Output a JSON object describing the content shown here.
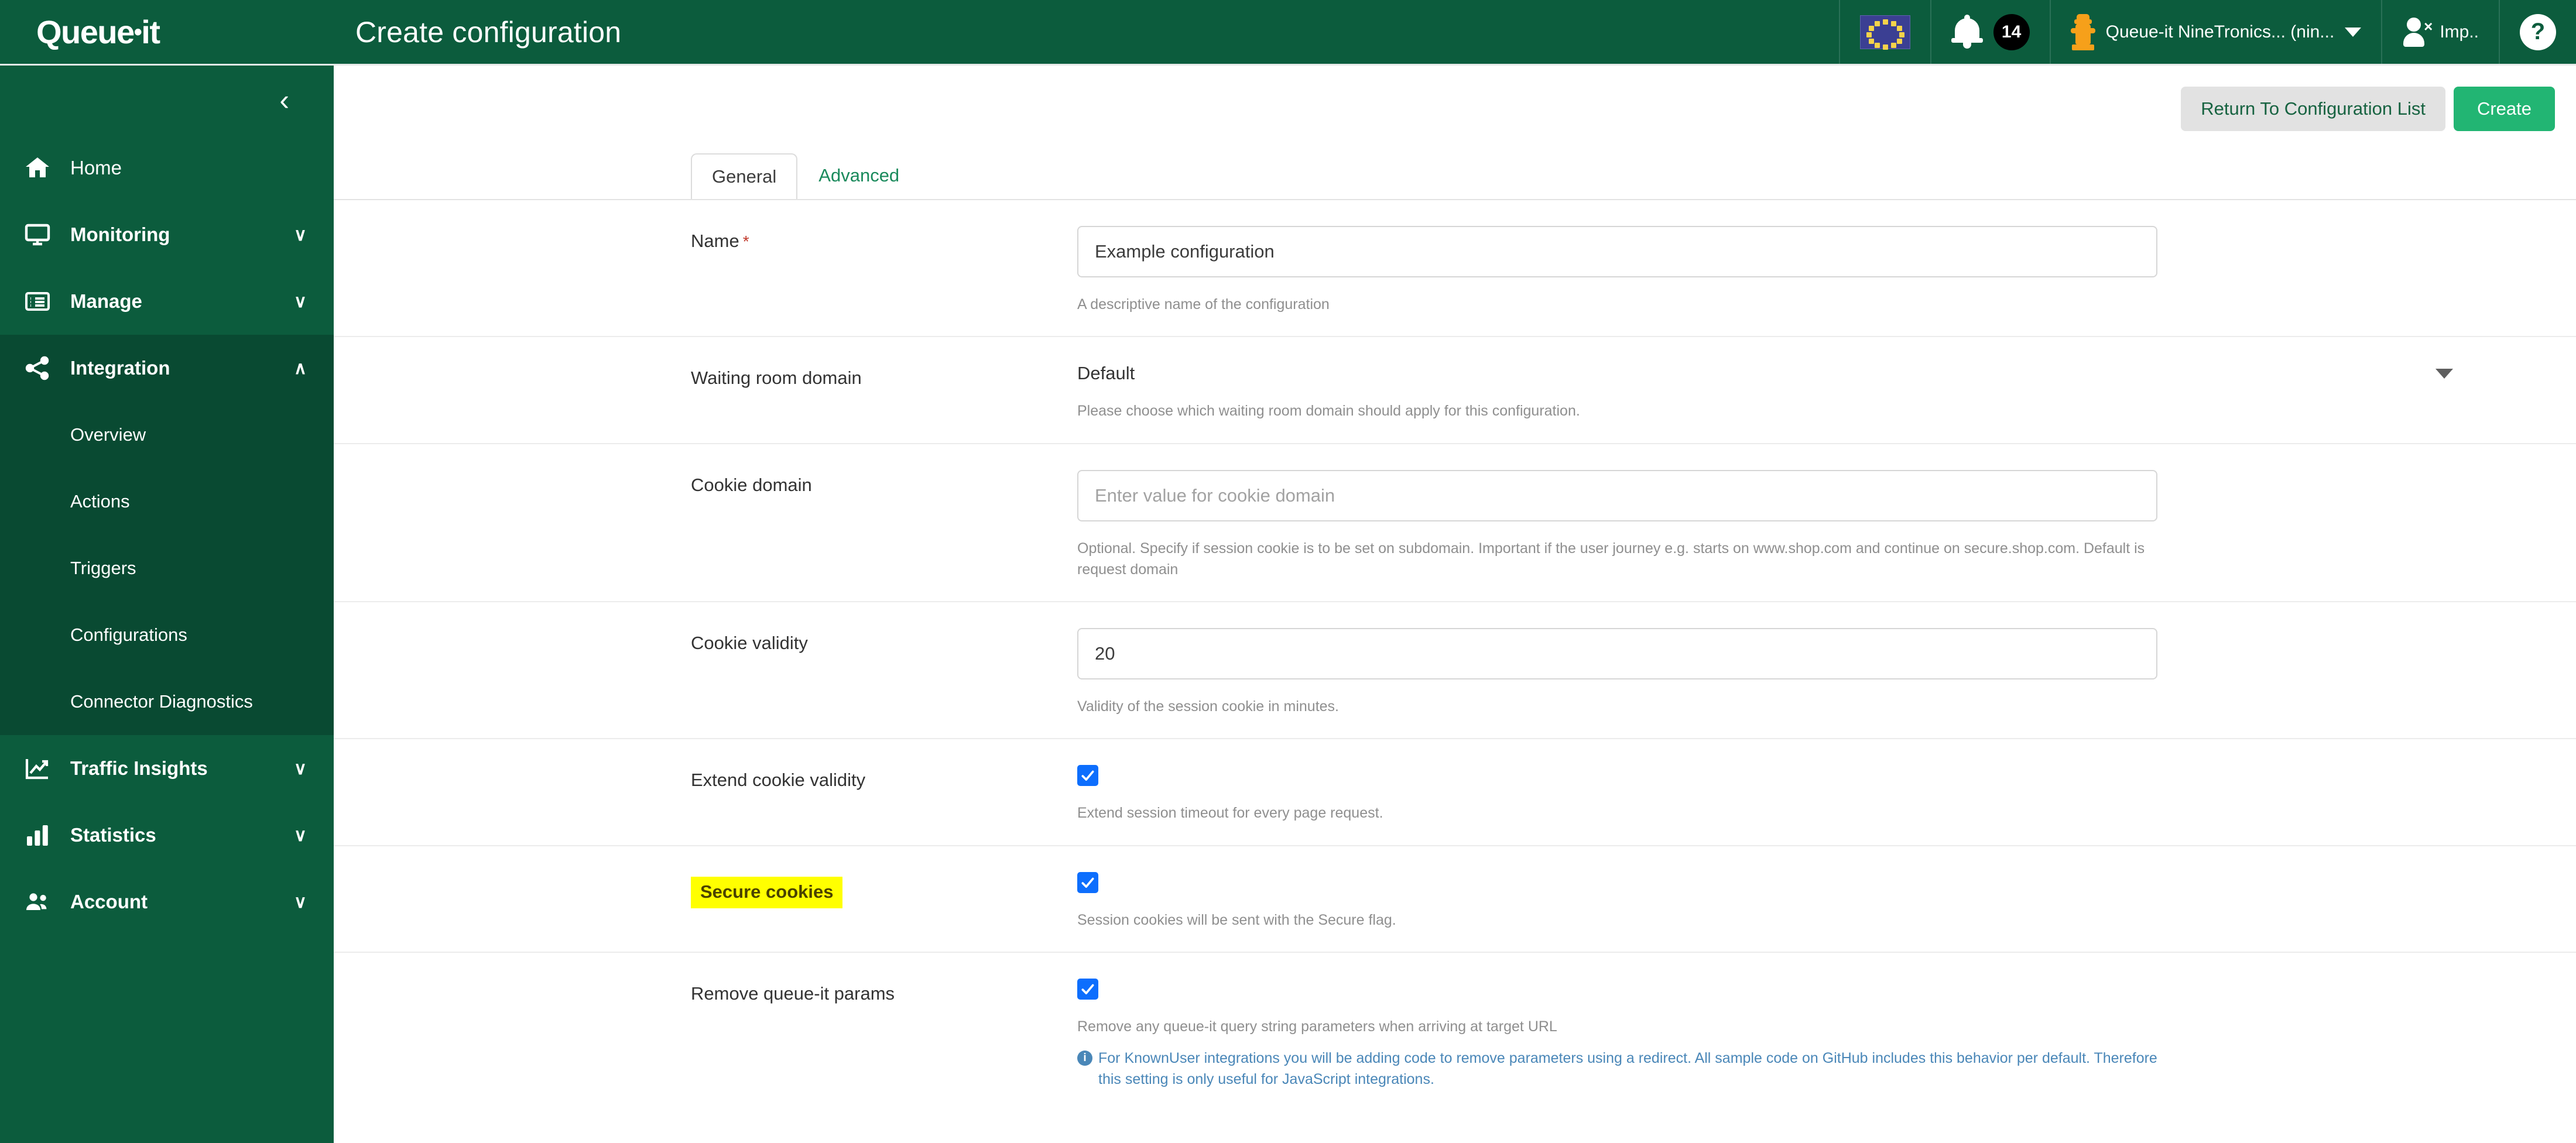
{
  "brand": {
    "name": "Queue",
    "dot": "•",
    "suffix": "it"
  },
  "header": {
    "title": "Create configuration",
    "locale_flag": "eu-flag-icon",
    "notifications_count": "14",
    "account_label": "Queue-it NineTronics... (nin...",
    "impersonate_label": "Imp..",
    "help_label": "?"
  },
  "sidebar": {
    "collapse_label": "‹",
    "items": [
      {
        "label": "Home",
        "icon": "home-icon",
        "caret": ""
      },
      {
        "label": "Monitoring",
        "icon": "monitor-icon",
        "caret": "∨"
      },
      {
        "label": "Manage",
        "icon": "list-icon",
        "caret": "∨"
      },
      {
        "label": "Integration",
        "icon": "share-nodes-icon",
        "caret": "∧"
      },
      {
        "label": "Traffic Insights",
        "icon": "line-chart-icon",
        "caret": "∨"
      },
      {
        "label": "Statistics",
        "icon": "bar-chart-icon",
        "caret": "∨"
      },
      {
        "label": "Account",
        "icon": "users-icon",
        "caret": "∨"
      }
    ],
    "integration_subitems": [
      {
        "label": "Overview"
      },
      {
        "label": "Actions"
      },
      {
        "label": "Triggers"
      },
      {
        "label": "Configurations"
      },
      {
        "label": "Connector Diagnostics"
      }
    ]
  },
  "toolbar": {
    "return_label": "Return To Configuration List",
    "create_label": "Create"
  },
  "tabs": [
    {
      "label": "General",
      "active": true
    },
    {
      "label": "Advanced",
      "active": false
    }
  ],
  "form": {
    "name": {
      "label": "Name",
      "required_marker": "*",
      "value": "Example configuration",
      "help": "A descriptive name of the configuration"
    },
    "waiting_room_domain": {
      "label": "Waiting room domain",
      "value": "Default",
      "help": "Please choose which waiting room domain should apply for this configuration."
    },
    "cookie_domain": {
      "label": "Cookie domain",
      "value": "",
      "placeholder": "Enter value for cookie domain",
      "help": "Optional. Specify if session cookie is to be set on subdomain. Important if the user journey e.g. starts on www.shop.com and continue on secure.shop.com. Default is request domain"
    },
    "cookie_validity": {
      "label": "Cookie validity",
      "value": "20",
      "help": "Validity of the session cookie in minutes."
    },
    "extend_cookie_validity": {
      "label": "Extend cookie validity",
      "checked": true,
      "help": "Extend session timeout for every page request."
    },
    "secure_cookies": {
      "label": "Secure cookies",
      "checked": true,
      "highlighted": true,
      "help": "Session cookies will be sent with the Secure flag."
    },
    "remove_queueit_params": {
      "label": "Remove queue-it params",
      "checked": true,
      "help": "Remove any queue-it query string parameters when arriving at target URL",
      "info": "For KnownUser integrations you will be adding code to remove parameters using a redirect. All sample code on GitHub includes this behavior per default. Therefore this setting is only useful for JavaScript integrations."
    }
  },
  "colors": {
    "brand_green": "#0c5c3d",
    "brand_green_dark": "#094a32",
    "create_green": "#22b573",
    "link_green": "#1a8a5c",
    "checkbox_blue": "#0d6efd",
    "highlight_yellow": "#ffff00",
    "info_blue": "#4a87b8",
    "required_red": "#c0392b"
  }
}
